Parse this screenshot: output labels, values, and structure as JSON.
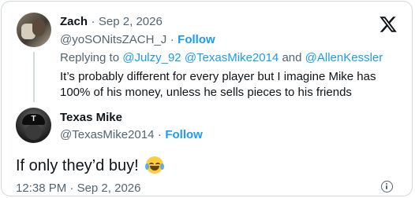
{
  "reply": {
    "author_name": "Zach",
    "separator": "·",
    "date": "Sep 2, 2026",
    "handle": "@yoSONitsZACH_J",
    "follow_label": "Follow",
    "replying_to_label": "Replying to",
    "replying_to_handles": [
      "@Julzy_92",
      "@TexasMike2014",
      "@AllenKessler"
    ],
    "replying_and": "and",
    "text_line1": "It’s probably different for every player but I imagine Mike has",
    "text_line2": "100% of his money, unless he sells pieces to his friends"
  },
  "main": {
    "author_name": "Texas Mike",
    "handle": "@TexasMike2014",
    "follow_label": "Follow",
    "text": "If only they’d buy!",
    "emoji": "face-with-tears-of-joy",
    "time": "12:38 PM",
    "date": "Sep 2, 2026",
    "avatar_letter": "T"
  },
  "icons": {
    "x_logo": "x-logo-icon",
    "info": "info-icon"
  },
  "colors": {
    "link": "#1d9bf0",
    "muted": "#536471",
    "text": "#0f1419",
    "border": "#cfd9de"
  }
}
